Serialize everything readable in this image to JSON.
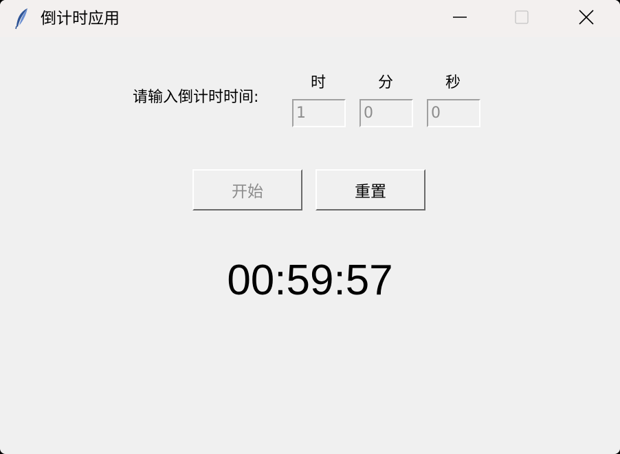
{
  "window": {
    "title": "倒计时应用",
    "app_icon": "feather-icon",
    "controls": {
      "minimize_icon": "minimize-icon",
      "maximize_icon": "maximize-icon",
      "close_icon": "close-icon"
    }
  },
  "form": {
    "prompt": "请输入倒计时时间:",
    "units": {
      "hours": "时",
      "minutes": "分",
      "seconds": "秒"
    },
    "inputs": {
      "hours": "1",
      "minutes": "0",
      "seconds": "0"
    }
  },
  "buttons": {
    "start": "开始",
    "reset": "重置"
  },
  "timer": {
    "display": "00:59:57"
  },
  "colors": {
    "background": "#f0f0f0",
    "titlebar": "#f3f0ef",
    "disabled_text": "#8c8c8c",
    "text": "#000000"
  }
}
